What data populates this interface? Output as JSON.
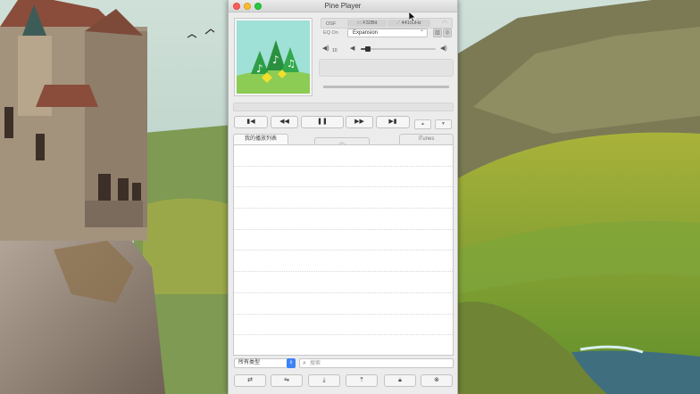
{
  "window": {
    "title": "Pine Player"
  },
  "info_strip": {
    "osf_label": "OSF",
    "format_value": "F32Bit",
    "rate_value": "44100Hz"
  },
  "eq": {
    "label": "EQ On",
    "selected": "Expansion"
  },
  "volume": {
    "level_label": "10",
    "level_fraction": 0.1
  },
  "playback": {
    "progress_fraction": 1.0
  },
  "transport": {
    "prev_icon": "skip-back-icon",
    "rewind_icon": "rewind-icon",
    "pause_icon": "pause-icon",
    "forward_icon": "fast-forward-icon",
    "next_icon": "skip-forward-icon"
  },
  "tabs": [
    {
      "label": "我的播放列表",
      "active": true
    },
    {
      "label": "",
      "active": false
    },
    {
      "label": "iTunes",
      "active": false
    }
  ],
  "playlist": {
    "rows": [
      "",
      "",
      "",
      "",
      "",
      "",
      "",
      "",
      "",
      ""
    ]
  },
  "filter": {
    "type_selected": "所有类型",
    "search_placeholder": "搜索"
  },
  "bottom_toolbar": [
    {
      "name": "repeat-icon"
    },
    {
      "name": "shuffle-icon"
    },
    {
      "name": "import-icon"
    },
    {
      "name": "export-icon"
    },
    {
      "name": "lock-icon"
    },
    {
      "name": "clear-icon"
    }
  ],
  "colors": {
    "accent": "#3d82f7",
    "artwork_sky": "#9fe0d7",
    "artwork_grass": "#8ccc55",
    "artwork_tree": "#2e9e45"
  }
}
